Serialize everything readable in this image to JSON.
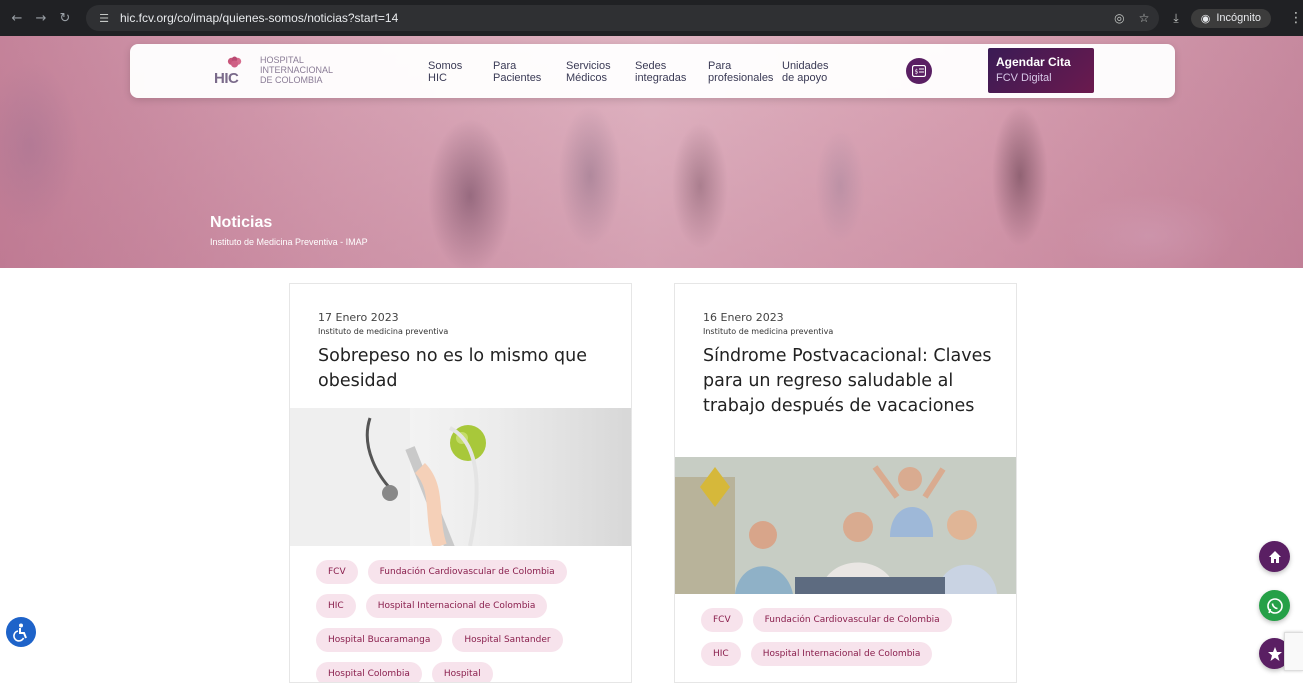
{
  "browser": {
    "url": "hic.fcv.org/co/imap/quienes-somos/noticias?start=14",
    "profile_label": "Incógnito"
  },
  "navbar": {
    "logo": {
      "abbr": "HIC",
      "line1": "HOSPITAL",
      "line2": "INTERNACIONAL",
      "line3": "DE COLOMBIA"
    },
    "items": [
      {
        "l1": "Somos",
        "l2": "HIC"
      },
      {
        "l1": "Para",
        "l2": "Pacientes"
      },
      {
        "l1": "Servicios",
        "l2": "Médicos"
      },
      {
        "l1": "Sedes",
        "l2": "integradas"
      },
      {
        "l1": "Para",
        "l2": "profesionales"
      },
      {
        "l1": "Unidades",
        "l2": "de apoyo"
      }
    ],
    "cta": {
      "title": "Agendar Cita",
      "subtitle": "FCV Digital"
    }
  },
  "hero": {
    "title": "Noticias",
    "subtitle": "Instituto de Medicina Preventiva - IMAP"
  },
  "articles": [
    {
      "date": "17 Enero 2023",
      "category": "Instituto de medicina preventiva",
      "title": "Sobrepeso no es lo mismo que obesidad",
      "tags": [
        "FCV",
        "Fundación Cardiovascular de Colombia",
        "HIC",
        "Hospital Internacional de Colombia",
        "Hospital Bucaramanga",
        "Hospital Santander",
        "Hospital Colombia",
        "Hospital"
      ]
    },
    {
      "date": "16 Enero 2023",
      "category": "Instituto de medicina preventiva",
      "title": "Síndrome Postvacacional: Claves para un regreso saludable al trabajo después de vacaciones",
      "tags": [
        "FCV",
        "Fundación Cardiovascular de Colombia",
        "HIC",
        "Hospital Internacional de Colombia"
      ]
    }
  ],
  "colors": {
    "brand_purple": "#5a1f63",
    "tag_bg": "#f7e3ec",
    "tag_text": "#8a1f4d",
    "whatsapp": "#25a047",
    "accessibility": "#1e63c9"
  },
  "icons": [
    "back-icon",
    "forward-icon",
    "reload-icon",
    "site-settings-icon",
    "eye-off-icon",
    "star-icon",
    "download-icon",
    "incognito-icon",
    "kebab-menu-icon",
    "payment-icon",
    "home-icon",
    "whatsapp-icon",
    "favorite-icon",
    "accessibility-icon"
  ]
}
